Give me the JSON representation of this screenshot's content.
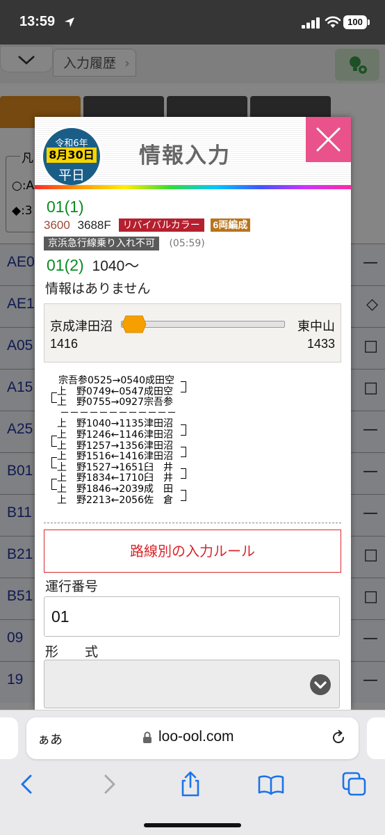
{
  "status_bar": {
    "time": "13:59",
    "battery": "100"
  },
  "page": {
    "history_label": "入力履歴",
    "legend": [
      "凡",
      "○:A",
      "◆:3"
    ],
    "rows": [
      {
        "id": "AE0",
        "mark": "—"
      },
      {
        "id": "AE1",
        "mark": "◇"
      },
      {
        "id": "A05",
        "mark": "□"
      },
      {
        "id": "A15",
        "mark": "□"
      },
      {
        "id": "A25",
        "mark": "—"
      },
      {
        "id": "B01",
        "mark": "—"
      },
      {
        "id": "B11",
        "mark": "—"
      },
      {
        "id": "B21",
        "mark": "□"
      },
      {
        "id": "B51",
        "mark": "□"
      },
      {
        "id": "09",
        "mark": "—"
      },
      {
        "id": "19",
        "mark": "—"
      }
    ]
  },
  "modal": {
    "date_badge": {
      "era": "令和6年",
      "day": "8月30日",
      "type": "平日"
    },
    "title": "情報入力",
    "run_id": "01(1)",
    "vehicle_no": "3600",
    "formation": "3688F",
    "tag_livery": "リバイバルカラー",
    "tag_cars": "6両編成",
    "restriction_tag": "京浜急行線乗り入れ不可",
    "restriction_time": "(05:59)",
    "run_id2": "01(2)",
    "run_time2": "1040〜",
    "no_info": "情報はありません",
    "range": {
      "from_station": "京成津田沼",
      "to_station": "東中山",
      "from_time": "1416",
      "to_time": "1433",
      "slider_fraction": 0.03
    },
    "diagram_lines": [
      "宗吾参0525→0540成田空",
      "上　野0749←0547成田空",
      "上　野0755→0927宗吾参",
      "－－－－－－－－－－－－",
      "上　野1040→1135津田沼",
      "上　野1246←1146津田沼",
      "上　野1257→1356津田沼",
      "上　野1516←1416津田沼",
      "上　野1527→1651臼　井",
      "上　野1834←1710臼　井",
      "上　野1846→2039成　田",
      "上　野2213←2056佐　倉"
    ],
    "rule_button": "路線別の入力ルール",
    "run_number_label": "運行番号",
    "run_number_value": "01",
    "type_label": "形　　式"
  },
  "browser": {
    "aa": "ぁあ",
    "url": "loo-ool.com"
  },
  "colors": {
    "run_id_green": "#0a8c22",
    "close_pink": "#e9528a",
    "rule_red": "#d9262b",
    "tag_red": "#b51f2e",
    "tag_gold": "#b8741c",
    "badge_blue": "#1a5e88",
    "slider_orange": "#f5a000"
  }
}
